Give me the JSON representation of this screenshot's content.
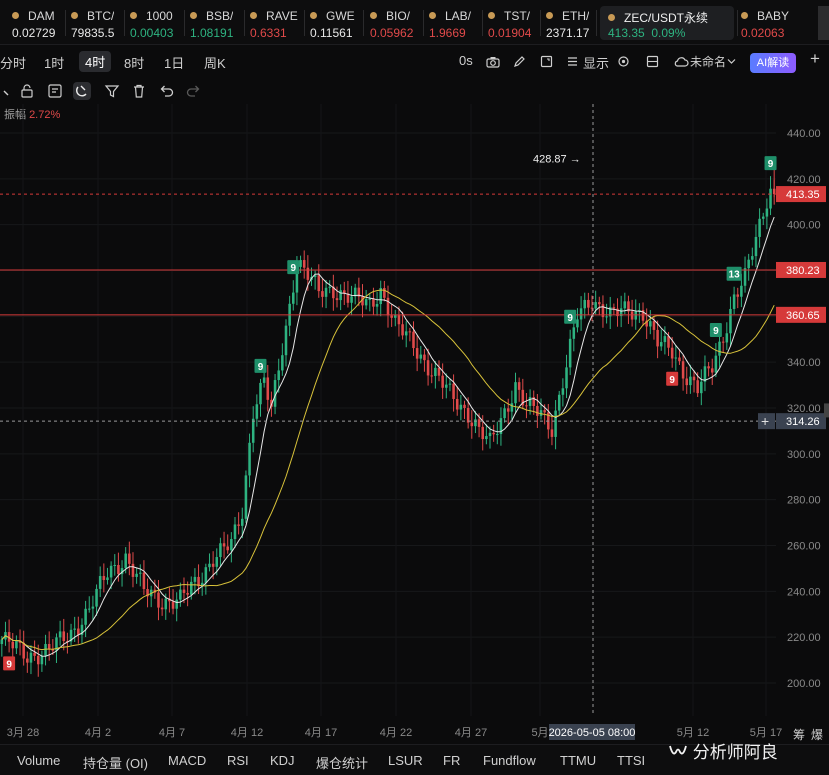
{
  "tickers": [
    {
      "symbol": "DAM",
      "price": "0.02729",
      "trend": "wh"
    },
    {
      "symbol": "BTC/",
      "price": "79835.5",
      "trend": "wh"
    },
    {
      "symbol": "1000",
      "price": "0.00403",
      "trend": "up"
    },
    {
      "symbol": "BSB/",
      "price": "1.08191",
      "trend": "up"
    },
    {
      "symbol": "RAVE",
      "price": "0.6331",
      "trend": "dn"
    },
    {
      "symbol": "GWE",
      "price": "0.11561",
      "trend": "wh"
    },
    {
      "symbol": "BIO/",
      "price": "0.05962",
      "trend": "dn"
    },
    {
      "symbol": "LAB/",
      "price": "1.9669",
      "trend": "dn"
    },
    {
      "symbol": "TST/",
      "price": "0.01904",
      "trend": "dn"
    },
    {
      "symbol": "ETH/",
      "price": "2371.17",
      "trend": "wh"
    }
  ],
  "active_ticker": {
    "symbol": "ZEC/USDT永续",
    "price": "413.35",
    "change": "0.09%"
  },
  "last_ticker": {
    "symbol": "BABY",
    "price": "0.02063"
  },
  "timeframes": [
    "分时",
    "1时",
    "4时",
    "8时",
    "1日",
    "周K"
  ],
  "active_timeframe": "4时",
  "toolbar": {
    "countdown": "0s",
    "display_label": "显示",
    "layout_name": "未命名",
    "ai_label": "AI解读",
    "add": "+"
  },
  "amplitude": {
    "label": "振幅",
    "value": "2.72%"
  },
  "bottom_tabs": [
    "Volume",
    "持仓量 (OI)",
    "MACD",
    "RSI",
    "KDJ",
    "爆仓统计",
    "LSUR",
    "FR",
    "Fundflow",
    "TTMU",
    "TTSI"
  ],
  "bottom_right": [
    "筹",
    "爆"
  ],
  "watermark": "分析师阿良",
  "colors": {
    "up": "#2eb381",
    "down": "#e04a4a",
    "hline": "#d63a3a",
    "label_green": "#1f8f6a",
    "ma_fast": "#e8e8e8",
    "ma_slow": "#d8c23a"
  },
  "chart_data": {
    "type": "candlestick",
    "symbol": "ZEC/USDT",
    "interval": "4h",
    "y_ticks": [
      200,
      220,
      240,
      260,
      280,
      300,
      320,
      340,
      360,
      380,
      400,
      420,
      440
    ],
    "ylim": [
      190,
      446
    ],
    "x_ticks": [
      "3月 28",
      "4月 2",
      "4月 7",
      "4月 12",
      "4月 17",
      "4月 22",
      "4月 27",
      "5月",
      "5月 12",
      "5月 17"
    ],
    "crosshair_x_label": "2026-05-05 08:00",
    "price_labels": [
      {
        "value": "413.35",
        "kind": "current"
      },
      {
        "value": "380.23",
        "kind": "hline"
      },
      {
        "value": "360.65",
        "kind": "hline"
      },
      {
        "value": "314.26",
        "kind": "crosshair"
      }
    ],
    "high_annotation": "428.87 →",
    "anchors": [
      [
        0,
        219
      ],
      [
        7,
        212
      ],
      [
        13,
        214
      ],
      [
        19,
        222
      ],
      [
        24,
        232
      ],
      [
        29,
        248
      ],
      [
        34,
        255
      ],
      [
        39,
        240
      ],
      [
        44,
        236
      ],
      [
        49,
        236
      ],
      [
        54,
        245
      ],
      [
        58,
        255
      ],
      [
        63,
        260
      ],
      [
        66,
        275
      ],
      [
        69,
        320
      ],
      [
        72,
        332
      ],
      [
        74,
        318
      ],
      [
        78,
        355
      ],
      [
        81,
        385
      ],
      [
        84,
        378
      ],
      [
        87,
        370
      ],
      [
        91,
        372
      ],
      [
        96,
        368
      ],
      [
        101,
        365
      ],
      [
        104,
        372
      ],
      [
        108,
        356
      ],
      [
        113,
        348
      ],
      [
        118,
        336
      ],
      [
        123,
        326
      ],
      [
        128,
        318
      ],
      [
        131,
        310
      ],
      [
        134,
        304
      ],
      [
        137,
        315
      ],
      [
        141,
        330
      ],
      [
        144,
        320
      ],
      [
        148,
        318
      ],
      [
        151,
        312
      ],
      [
        155,
        338
      ],
      [
        158,
        360
      ],
      [
        162,
        368
      ],
      [
        167,
        360
      ],
      [
        172,
        363
      ],
      [
        176,
        362
      ],
      [
        180,
        348
      ],
      [
        184,
        345
      ],
      [
        188,
        334
      ],
      [
        191,
        328
      ],
      [
        195,
        338
      ],
      [
        198,
        352
      ],
      [
        201,
        368
      ],
      [
        204,
        376
      ],
      [
        207,
        394
      ],
      [
        210,
        412
      ],
      [
        212,
        420
      ]
    ],
    "markers": [
      {
        "text": "9",
        "kind": "buy",
        "at": 2
      },
      {
        "text": "9",
        "kind": "sell",
        "at": 71
      },
      {
        "text": "9",
        "kind": "sell",
        "at": 80
      },
      {
        "text": "9",
        "kind": "sell",
        "at": 156
      },
      {
        "text": "9",
        "kind": "buy",
        "at": 184
      },
      {
        "text": "9",
        "kind": "sell",
        "at": 196
      },
      {
        "text": "13",
        "kind": "sell",
        "at": 201
      },
      {
        "text": "9",
        "kind": "sell",
        "at": 211
      }
    ]
  }
}
